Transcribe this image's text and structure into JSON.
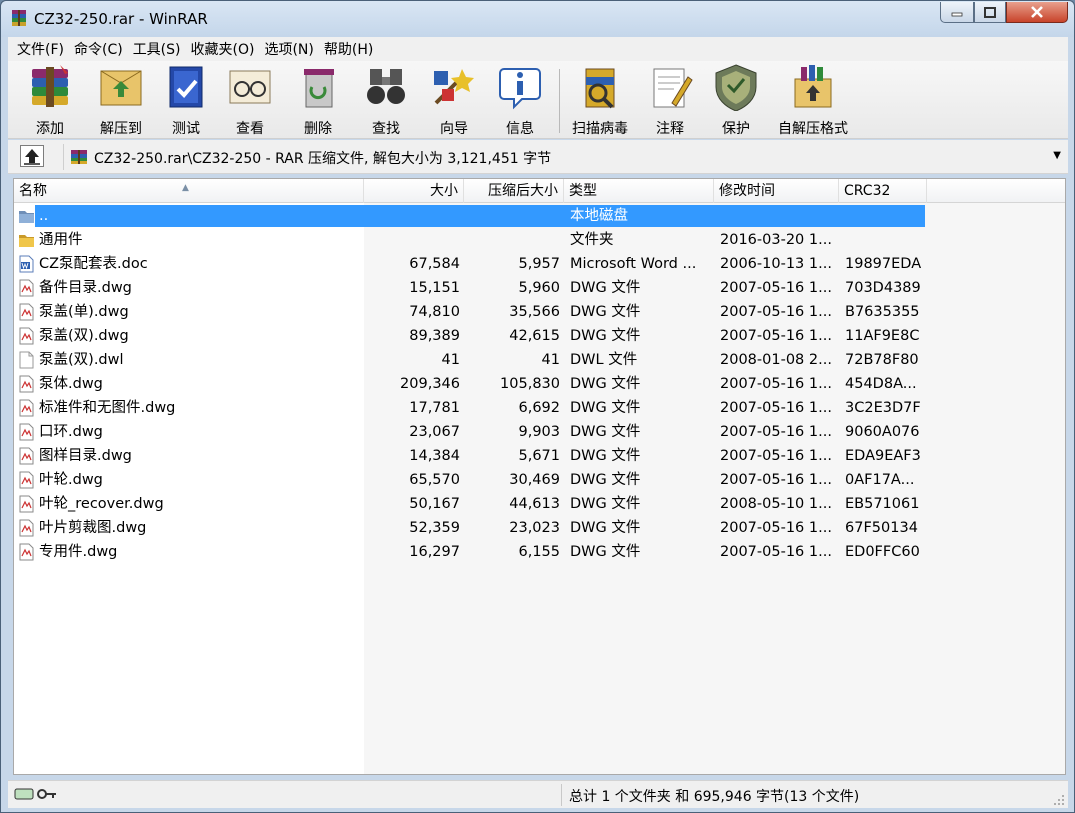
{
  "window": {
    "title": "CZ32-250.rar - WinRAR"
  },
  "menu": [
    "文件(F)",
    "命令(C)",
    "工具(S)",
    "收藏夹(O)",
    "选项(N)",
    "帮助(H)"
  ],
  "toolbar": [
    {
      "label": "添加",
      "icon": "add-archive-icon"
    },
    {
      "label": "解压到",
      "icon": "extract-to-icon"
    },
    {
      "label": "测试",
      "icon": "test-icon"
    },
    {
      "label": "查看",
      "icon": "view-icon"
    },
    {
      "label": "删除",
      "icon": "delete-icon"
    },
    {
      "label": "查找",
      "icon": "find-icon"
    },
    {
      "label": "向导",
      "icon": "wizard-icon"
    },
    {
      "label": "信息",
      "icon": "info-icon"
    },
    {
      "label": "扫描病毒",
      "icon": "virus-scan-icon"
    },
    {
      "label": "注释",
      "icon": "comment-icon"
    },
    {
      "label": "保护",
      "icon": "protect-icon"
    },
    {
      "label": "自解压格式",
      "icon": "sfx-icon"
    }
  ],
  "address": {
    "path": "CZ32-250.rar\\CZ32-250 - RAR 压缩文件, 解包大小为 3,121,451 字节"
  },
  "columns": {
    "name": "名称",
    "size": "大小",
    "packed": "压缩后大小",
    "type": "类型",
    "modified": "修改时间",
    "crc": "CRC32"
  },
  "files": [
    {
      "name": "..",
      "size": "",
      "packed": "",
      "type": "本地磁盘",
      "modified": "",
      "crc": "",
      "icon": "parent-folder-icon",
      "selected": true
    },
    {
      "name": "通用件",
      "size": "",
      "packed": "",
      "type": "文件夹",
      "modified": "2016-03-20 1...",
      "crc": "",
      "icon": "folder-icon"
    },
    {
      "name": "CZ泵配套表.doc",
      "size": "67,584",
      "packed": "5,957",
      "type": "Microsoft Word ...",
      "modified": "2006-10-13 1...",
      "crc": "19897EDA",
      "icon": "word-doc-icon"
    },
    {
      "name": "备件目录.dwg",
      "size": "15,151",
      "packed": "5,960",
      "type": "DWG 文件",
      "modified": "2007-05-16 1...",
      "crc": "703D4389",
      "icon": "dwg-file-icon"
    },
    {
      "name": "泵盖(单).dwg",
      "size": "74,810",
      "packed": "35,566",
      "type": "DWG 文件",
      "modified": "2007-05-16 1...",
      "crc": "B7635355",
      "icon": "dwg-file-icon"
    },
    {
      "name": "泵盖(双).dwg",
      "size": "89,389",
      "packed": "42,615",
      "type": "DWG 文件",
      "modified": "2007-05-16 1...",
      "crc": "11AF9E8C",
      "icon": "dwg-file-icon"
    },
    {
      "name": "泵盖(双).dwl",
      "size": "41",
      "packed": "41",
      "type": "DWL 文件",
      "modified": "2008-01-08 2...",
      "crc": "72B78F80",
      "icon": "blank-file-icon"
    },
    {
      "name": "泵体.dwg",
      "size": "209,346",
      "packed": "105,830",
      "type": "DWG 文件",
      "modified": "2007-05-16 1...",
      "crc": "454D8A...",
      "icon": "dwg-file-icon"
    },
    {
      "name": "标准件和无图件.dwg",
      "size": "17,781",
      "packed": "6,692",
      "type": "DWG 文件",
      "modified": "2007-05-16 1...",
      "crc": "3C2E3D7F",
      "icon": "dwg-file-icon"
    },
    {
      "name": "口环.dwg",
      "size": "23,067",
      "packed": "9,903",
      "type": "DWG 文件",
      "modified": "2007-05-16 1...",
      "crc": "9060A076",
      "icon": "dwg-file-icon"
    },
    {
      "name": "图样目录.dwg",
      "size": "14,384",
      "packed": "5,671",
      "type": "DWG 文件",
      "modified": "2007-05-16 1...",
      "crc": "EDA9EAF3",
      "icon": "dwg-file-icon"
    },
    {
      "name": "叶轮.dwg",
      "size": "65,570",
      "packed": "30,469",
      "type": "DWG 文件",
      "modified": "2007-05-16 1...",
      "crc": "0AF17A...",
      "icon": "dwg-file-icon"
    },
    {
      "name": "叶轮_recover.dwg",
      "size": "50,167",
      "packed": "44,613",
      "type": "DWG 文件",
      "modified": "2008-05-10 1...",
      "crc": "EB571061",
      "icon": "dwg-file-icon"
    },
    {
      "name": "叶片剪裁图.dwg",
      "size": "52,359",
      "packed": "23,023",
      "type": "DWG 文件",
      "modified": "2007-05-16 1...",
      "crc": "67F50134",
      "icon": "dwg-file-icon"
    },
    {
      "name": "专用件.dwg",
      "size": "16,297",
      "packed": "6,155",
      "type": "DWG 文件",
      "modified": "2007-05-16 1...",
      "crc": "ED0FFC60",
      "icon": "dwg-file-icon"
    }
  ],
  "status": {
    "summary": "总计 1 个文件夹 和 695,946 字节(13 个文件)"
  },
  "colors": {
    "selection": "#3399ff",
    "titlebar": "#c4d6ea"
  }
}
